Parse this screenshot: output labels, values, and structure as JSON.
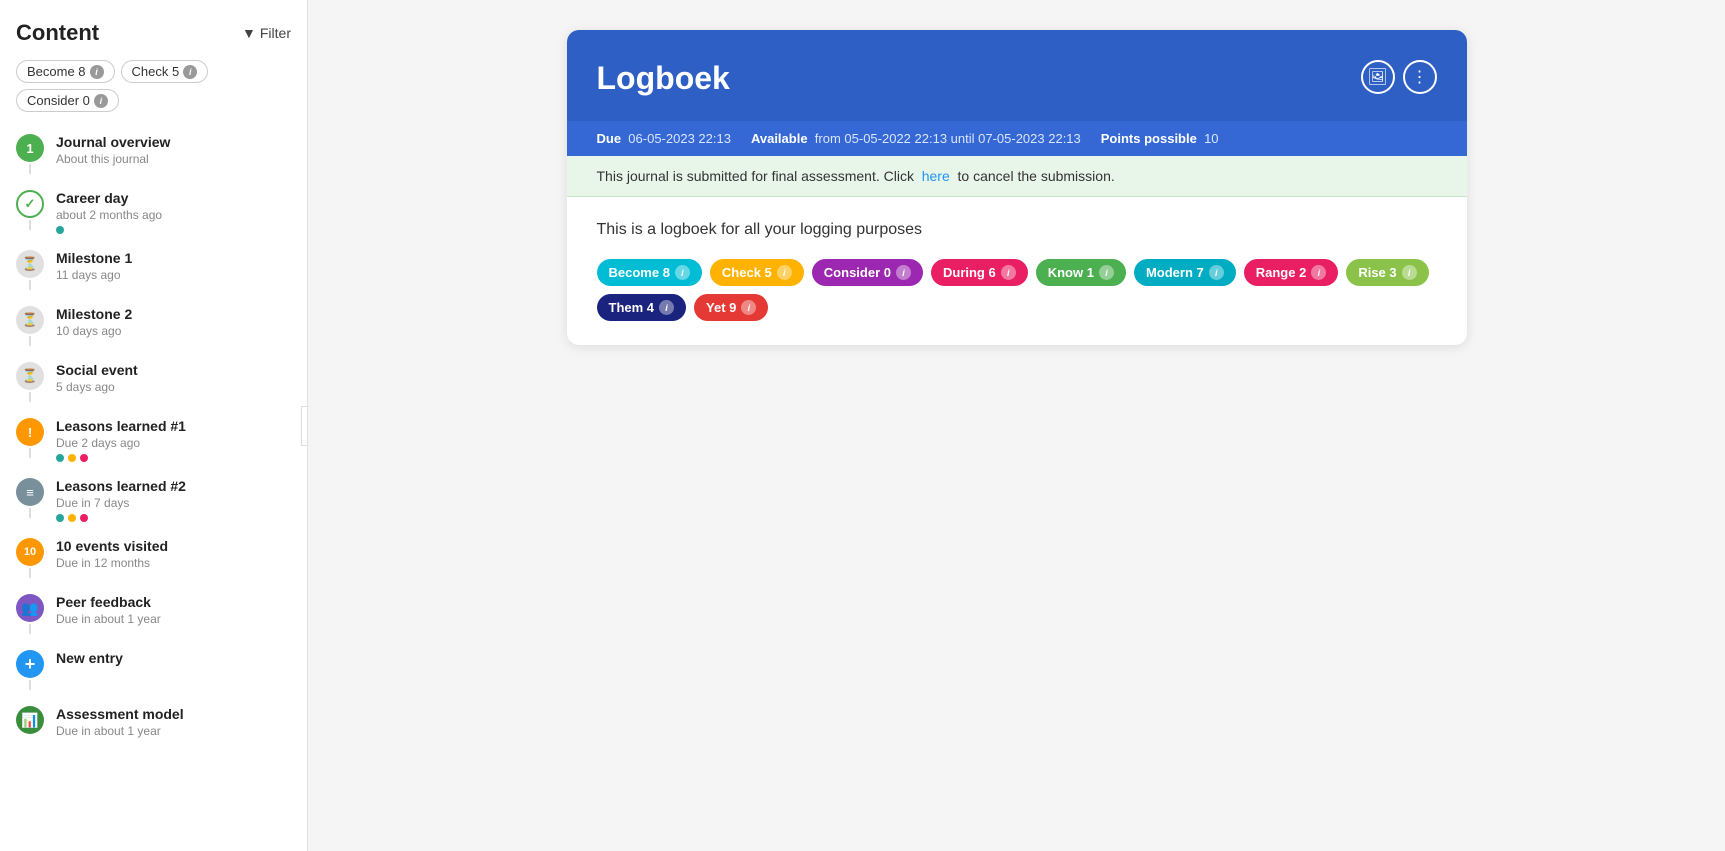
{
  "sidebar": {
    "title": "Content",
    "filter_label": "Filter",
    "filter_tags": [
      {
        "label": "Become 8",
        "id": "become"
      },
      {
        "label": "Check 5",
        "id": "check"
      },
      {
        "label": "Consider 0",
        "id": "consider"
      }
    ],
    "items": [
      {
        "id": "journal-overview",
        "icon": "1",
        "icon_bg": "bg-green",
        "title": "Journal overview",
        "sub": "About this journal",
        "dots": [],
        "has_check": false
      },
      {
        "id": "career-day",
        "icon": "✓",
        "icon_bg": "bg-white-check",
        "title": "Career day",
        "sub": "about 2 months ago",
        "dots": [
          "#26a69a"
        ],
        "has_check": true
      },
      {
        "id": "milestone-1",
        "icon": "⏳",
        "icon_bg": "bg-none",
        "title": "Milestone 1",
        "sub": "11 days ago",
        "dots": [],
        "has_check": false
      },
      {
        "id": "milestone-2",
        "icon": "⏳",
        "icon_bg": "bg-none",
        "title": "Milestone 2",
        "sub": "10 days ago",
        "dots": [],
        "has_check": false
      },
      {
        "id": "social-event",
        "icon": "⏳",
        "icon_bg": "bg-none",
        "title": "Social event",
        "sub": "5 days ago",
        "dots": [],
        "has_check": false
      },
      {
        "id": "lessons-1",
        "icon": "!",
        "icon_bg": "bg-orange",
        "title": "Leasons learned #1",
        "sub": "Due 2 days ago",
        "dots": [
          "#26a69a",
          "#ffb300",
          "#e91e63"
        ],
        "has_check": false
      },
      {
        "id": "lessons-2",
        "icon": "📋",
        "icon_bg": "bg-gray",
        "title": "Leasons learned #2",
        "sub": "Due in 7 days",
        "dots": [
          "#26a69a",
          "#ffb300",
          "#e91e63"
        ],
        "has_check": false
      },
      {
        "id": "events-visited",
        "icon": "10",
        "icon_bg": "bg-orange",
        "title": "10 events visited",
        "sub": "Due in 12 months",
        "dots": [],
        "has_check": false
      },
      {
        "id": "peer-feedback",
        "icon": "👥",
        "icon_bg": "bg-purple",
        "title": "Peer feedback",
        "sub": "Due in about 1 year",
        "dots": [],
        "has_check": false
      },
      {
        "id": "new-entry",
        "icon": "+",
        "icon_bg": "bg-blue",
        "title": "New entry",
        "sub": "",
        "dots": [],
        "has_check": false
      },
      {
        "id": "assessment-model",
        "icon": "📊",
        "icon_bg": "bg-green2",
        "title": "Assessment model",
        "sub": "Due in about 1 year",
        "dots": [],
        "has_check": false
      }
    ]
  },
  "card": {
    "title": "Logboek",
    "header_bg": "#2d5fc4",
    "due_label": "Due",
    "due_value": "06-05-2023 22:13",
    "available_label": "Available",
    "available_value": "from 05-05-2022 22:13 until 07-05-2023 22:13",
    "points_label": "Points possible",
    "points_value": "10",
    "notice": "This journal is submitted for final assessment. Click",
    "notice_link": "here",
    "notice_end": "to cancel the submission.",
    "description": "This is a logboek for all your logging purposes",
    "actions": [
      {
        "id": "image-btn",
        "icon": "🖼"
      },
      {
        "id": "more-btn",
        "icon": "⋮"
      }
    ],
    "tags": [
      {
        "label": "Become 8",
        "id": "become",
        "color_class": "tag-become"
      },
      {
        "label": "Check 5",
        "id": "check",
        "color_class": "tag-check"
      },
      {
        "label": "Consider 0",
        "id": "consider",
        "color_class": "tag-consider"
      },
      {
        "label": "During 6",
        "id": "during",
        "color_class": "tag-during"
      },
      {
        "label": "Know 1",
        "id": "know",
        "color_class": "tag-know"
      },
      {
        "label": "Modern 7",
        "id": "modern",
        "color_class": "tag-modern"
      },
      {
        "label": "Range 2",
        "id": "range",
        "color_class": "tag-range"
      },
      {
        "label": "Rise 3",
        "id": "rise",
        "color_class": "tag-rise"
      },
      {
        "label": "Them 4",
        "id": "them",
        "color_class": "tag-them"
      },
      {
        "label": "Yet 9",
        "id": "yet",
        "color_class": "tag-yet"
      }
    ]
  }
}
